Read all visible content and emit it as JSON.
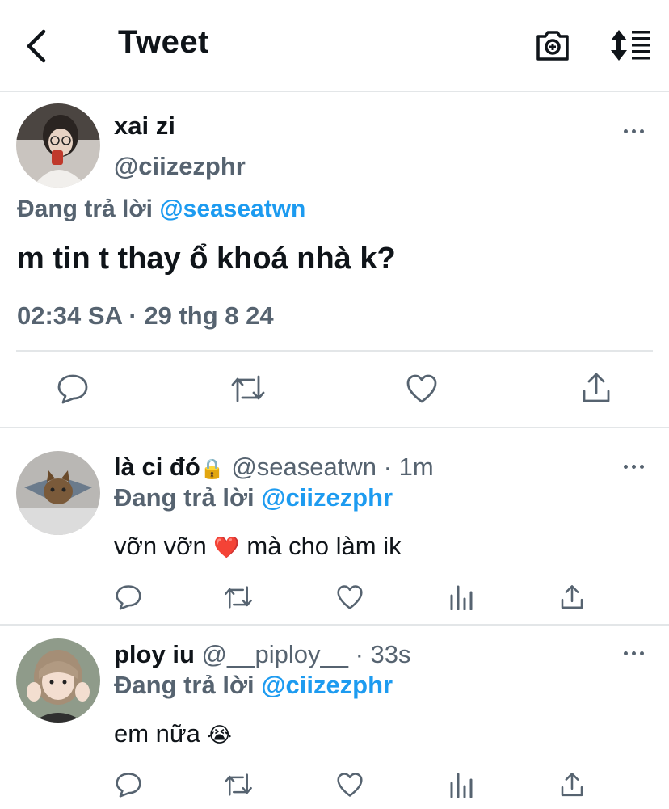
{
  "header": {
    "title": "Tweet",
    "back_icon": "chevron-left-icon",
    "camera_icon": "camera-plus-icon",
    "sort_icon": "sort-lines-icon"
  },
  "main_tweet": {
    "display_name": "xai zi",
    "handle": "@ciizezphr",
    "replying_prefix": "Đang trả lời",
    "replying_to": "@seaseatwn",
    "text": "m tin t thay ổ khoá nhà k?",
    "timestamp": "02:34 SA · 29 thg 8 24"
  },
  "replies": [
    {
      "display_name": "là ci đó",
      "lock": "🔒",
      "handle": "@seaseatwn",
      "dot": "·",
      "time": "1m",
      "replying_prefix": "Đang trả lời",
      "replying_to": "@ciizezphr",
      "text": "vỡn vỡn",
      "emoji": "❤️",
      "text2": "mà cho làm ik"
    },
    {
      "display_name": "ploy iu",
      "handle": "@__piploy__",
      "dot": "·",
      "time": "33s",
      "replying_prefix": "Đang trả lời",
      "replying_to": "@ciizezphr",
      "text": "em nữa",
      "emoji": "😭"
    }
  ],
  "colors": {
    "accent": "#1d9bf0",
    "muted": "#566370",
    "text": "#0f1419",
    "divider": "#e3e6e8"
  }
}
